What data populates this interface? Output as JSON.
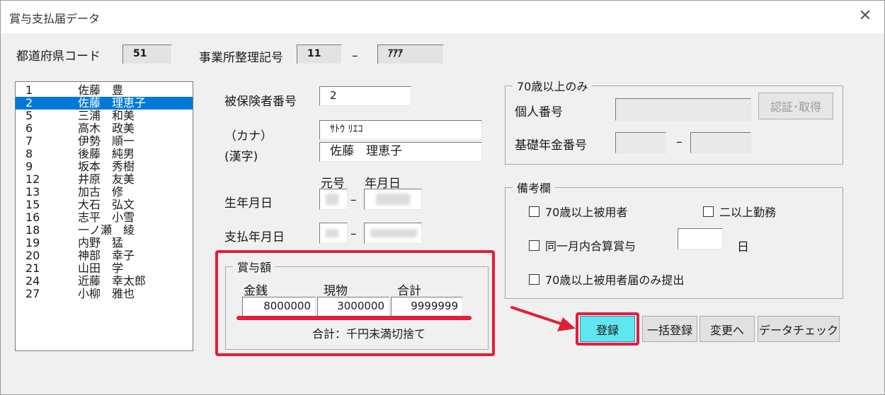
{
  "window": {
    "title": "賞与支払届データ"
  },
  "header": {
    "prefecture_label": "都道府県コード",
    "prefecture_code": "51",
    "office_label": "事業所整理記号",
    "office_code_1": "11",
    "office_dash": "–",
    "office_code_2": "ｱｱｱ"
  },
  "employees": [
    {
      "no": "1",
      "name": "佐藤　豊"
    },
    {
      "no": "2",
      "name": "佐藤　理恵子"
    },
    {
      "no": "5",
      "name": "三浦　和美"
    },
    {
      "no": "6",
      "name": "高木　政美"
    },
    {
      "no": "7",
      "name": "伊勢　順一"
    },
    {
      "no": "8",
      "name": "後藤　純男"
    },
    {
      "no": "9",
      "name": "坂本　秀樹"
    },
    {
      "no": "12",
      "name": "井原　友美"
    },
    {
      "no": "13",
      "name": "加古　修"
    },
    {
      "no": "15",
      "name": "大石　弘文"
    },
    {
      "no": "16",
      "name": "志平　小雪"
    },
    {
      "no": "18",
      "name": "一ノ瀬　綾"
    },
    {
      "no": "19",
      "name": "内野　猛"
    },
    {
      "no": "20",
      "name": "神部　幸子"
    },
    {
      "no": "21",
      "name": "山田　学"
    },
    {
      "no": "24",
      "name": "近藤　幸太郎"
    },
    {
      "no": "27",
      "name": "小柳　雅也"
    }
  ],
  "form": {
    "insured_no_label": "被保険者番号",
    "insured_no": "2",
    "kana_label": "（カナ）",
    "kana": "ｻﾄｳ ﾘｴｺ",
    "kanji_label": "(漢字)",
    "kanji": "佐藤　理恵子",
    "era_label": "元号",
    "ymd_label": "年月日",
    "birth_label": "生年月日",
    "pay_label": "支払年月日",
    "dash": "–"
  },
  "bonus": {
    "legend": "賞与額",
    "cash_label": "金銭",
    "goods_label": "現物",
    "total_label": "合計",
    "cash": "8000000",
    "goods": "3000000",
    "total": "9999999",
    "note": "合計：千円未満切捨て"
  },
  "over70": {
    "legend": "70歳以上のみ",
    "personal_no_label": "個人番号",
    "auth_button": "認証･取得",
    "pension_label": "基礎年金番号",
    "dash": "–"
  },
  "remarks": {
    "legend": "備考欄",
    "opt_over70": "70歳以上被用者",
    "opt_multi": "二以上勤務",
    "opt_same_month": "同一月内合算賞与",
    "day_unit": "日",
    "opt_over70_only": "70歳以上被用者届のみ提出"
  },
  "buttons": {
    "register": "登録",
    "bulk": "一括登録",
    "change": "変更へ",
    "check": "データチェック"
  },
  "colors": {
    "accent_red": "#e31e3a",
    "selected_blue": "#0078d7",
    "register_cyan": "#5fe6ef"
  }
}
